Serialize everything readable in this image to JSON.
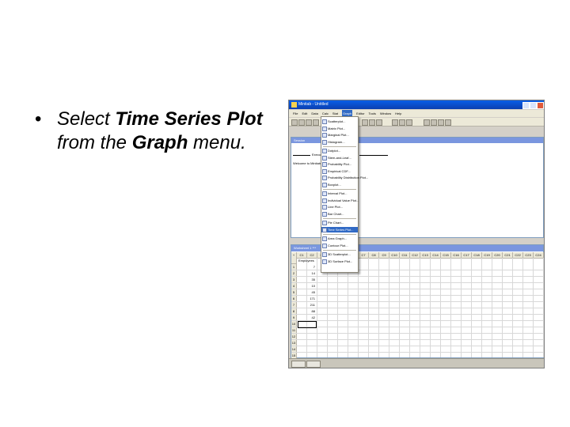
{
  "slide": {
    "bullet": "•",
    "t1": "Select ",
    "b1": "Time Series Plot",
    "t2": " from the ",
    "b2": "Graph",
    "t3": " menu."
  },
  "app": {
    "title": "Minitab - Untitled",
    "menu": [
      "File",
      "Edit",
      "Data",
      "Calc",
      "Stat",
      "Graph",
      "Editor",
      "Tools",
      "Window",
      "Help"
    ],
    "active_menu": "Graph",
    "session_title": "Session",
    "session_line": "Welcome to Minitab, press F1 for help.",
    "session_header": "Executing",
    "worksheet_title": "Worksheet 1 ***",
    "column_headers": [
      "+",
      "C1",
      "C2",
      "C3",
      "C4",
      "C5",
      "C6",
      "C7",
      "C8",
      "C9",
      "C10",
      "C11",
      "C12",
      "C13",
      "C14",
      "C15",
      "C16",
      "C17",
      "C18",
      "C19",
      "C20",
      "C21",
      "C22",
      "C23",
      "C24"
    ],
    "first_col_name": "Employees",
    "rows": [
      {
        "n": "1",
        "v": "7"
      },
      {
        "n": "2",
        "v": "14"
      },
      {
        "n": "3",
        "v": "35"
      },
      {
        "n": "4",
        "v": "10"
      },
      {
        "n": "5",
        "v": "45"
      },
      {
        "n": "6",
        "v": "171"
      },
      {
        "n": "7",
        "v": "211"
      },
      {
        "n": "8",
        "v": "88"
      },
      {
        "n": "9",
        "v": "42"
      },
      {
        "n": "10",
        "v": ""
      },
      {
        "n": "11",
        "v": ""
      },
      {
        "n": "12",
        "v": ""
      },
      {
        "n": "13",
        "v": ""
      },
      {
        "n": "14",
        "v": ""
      },
      {
        "n": "15",
        "v": ""
      }
    ],
    "graph_menu": [
      "Scatterplot...",
      "Matrix Plot...",
      "Marginal Plot...",
      "Histogram...",
      "Dotplot...",
      "Stem-and-Leaf...",
      "Probability Plot...",
      "Empirical CDF...",
      "Probability Distribution Plot...",
      "Boxplot...",
      "Interval Plot...",
      "Individual Value Plot...",
      "Line Plot...",
      "Bar Chart...",
      "Pie Chart...",
      "Time Series Plot...",
      "Area Graph...",
      "Contour Plot...",
      "3D Scatterplot...",
      "3D Surface Plot..."
    ],
    "selected_graph_item": "Time Series Plot..."
  }
}
